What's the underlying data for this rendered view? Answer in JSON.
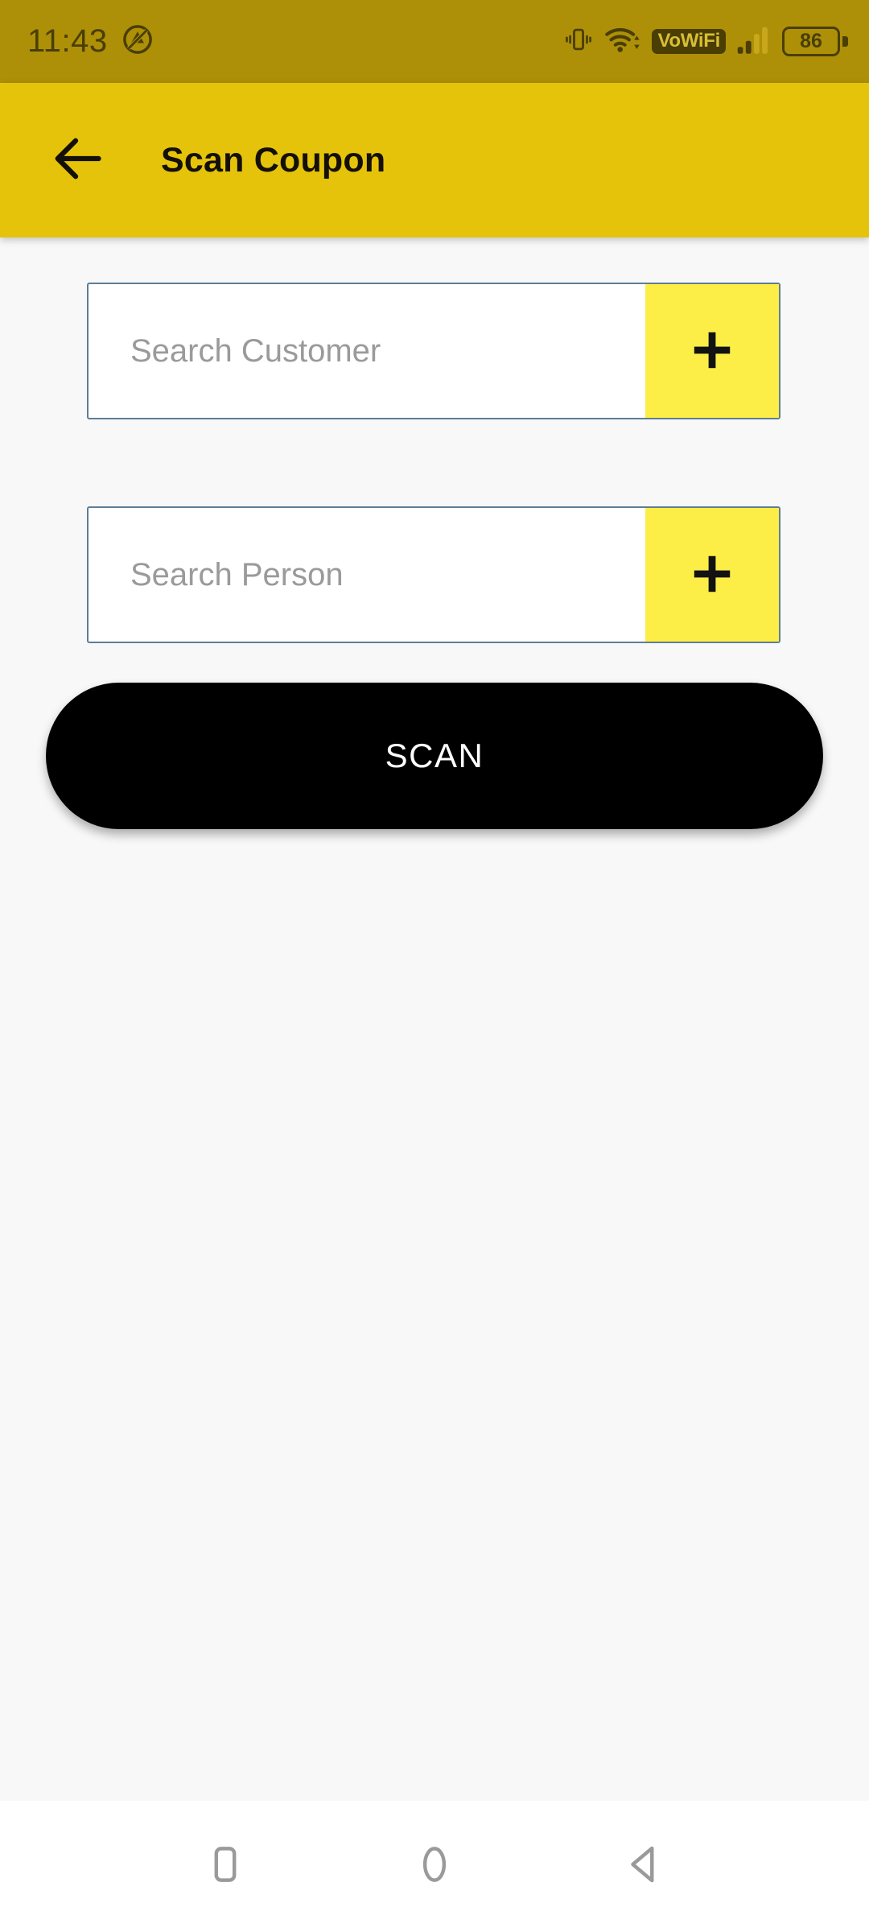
{
  "status_bar": {
    "time": "11:43",
    "left_icons": [
      {
        "name": "dnd-slash-icon"
      }
    ],
    "right_icons": [
      {
        "name": "vibrate-icon"
      },
      {
        "name": "wifi-icon"
      }
    ],
    "vowifi_label": "VoWiFi",
    "signal_name": "cellular-signal-icon",
    "battery_level": "86",
    "background_color": "#AD9007",
    "foreground_color": "#4A3E05"
  },
  "app_bar": {
    "back_icon": "back-arrow-icon",
    "title": "Scan Coupon",
    "background_color": "#E5C30B",
    "title_color": "#141008"
  },
  "form": {
    "customer_field": {
      "placeholder": "Search Customer",
      "value": "",
      "add_icon": "plus-icon"
    },
    "person_field": {
      "placeholder": "Search Person",
      "value": "",
      "add_icon": "plus-icon"
    },
    "scan_button_label": "SCAN",
    "field_border_color": "#5F7D95",
    "add_button_color": "#FCEE47",
    "scan_button_color": "#000000",
    "placeholder_color": "#9A9A9A"
  },
  "nav_bar": {
    "recents_icon": "square-recents-icon",
    "home_icon": "circle-home-icon",
    "back_icon": "triangle-back-icon",
    "icon_color": "#9A9A9A",
    "background_color": "#FFFFFF"
  },
  "page_background": "#F8F8F8"
}
